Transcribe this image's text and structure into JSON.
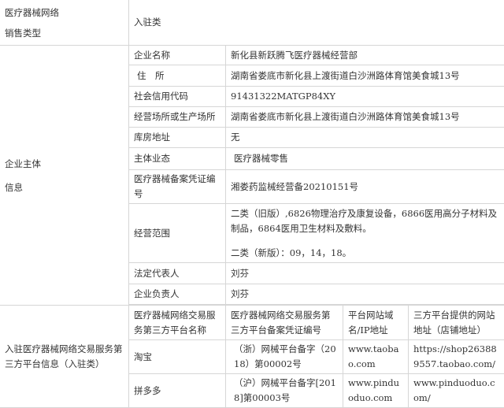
{
  "sales_type": {
    "label_line1": "医疗器械网络",
    "label_line2": "销售类型",
    "value": "入驻类"
  },
  "entity": {
    "section_line1": "企业主体",
    "section_line2": "信息",
    "rows": [
      {
        "label": "企业名称",
        "value": "新化县新跃腾飞医疗器械经营部"
      },
      {
        "label": "住　所",
        "value": "湖南省娄底市新化县上渡街道白沙洲路体育馆美食城13号"
      },
      {
        "label": "社会信用代码",
        "value": "91431322MATGP84XY"
      },
      {
        "label": "经营场所或生产场所",
        "value": "湖南省娄底市新化县上渡街道白沙洲路体育馆美食城13号"
      },
      {
        "label": "库房地址",
        "value": "无"
      },
      {
        "label": "主体业态",
        "value": "医疗器械零售"
      },
      {
        "label": "医疗器械备案凭证编号",
        "value": "湘娄药监械经营备20210151号"
      },
      {
        "label": "经营范围",
        "value": "二类（旧版）,6826物理治疗及康复设备，6866医用高分子材料及制品，6864医用卫生材料及敷料。",
        "value2": "二类（新版）：09，14，18。"
      },
      {
        "label": "法定代表人",
        "value": "刘芬"
      },
      {
        "label": "企业负责人",
        "value": "刘芬"
      }
    ]
  },
  "platform": {
    "section_line1": "入驻医疗器械网络交易服务第",
    "section_line2": "三方平台信息（入驻类）",
    "headers": [
      "医疗器械网络交易服务第三方平台名称",
      "医疗器械网络交易服务第三方平台备案凭证编号",
      "平台网站域名/IP地址",
      "三方平台提供的网站地址（店铺地址）"
    ],
    "rows": [
      {
        "name": "淘宝",
        "record": "（浙）网械平台备字（2018）第00002号",
        "domain": "www.taobao.com",
        "shop": "https://shop263889557.taobao.com/"
      },
      {
        "name": "拼多多",
        "record": "（沪）网械平台备字[2018]第00003号",
        "domain": "www.pinduoduo.com",
        "shop": "www.pinduoduo.com/"
      }
    ]
  }
}
